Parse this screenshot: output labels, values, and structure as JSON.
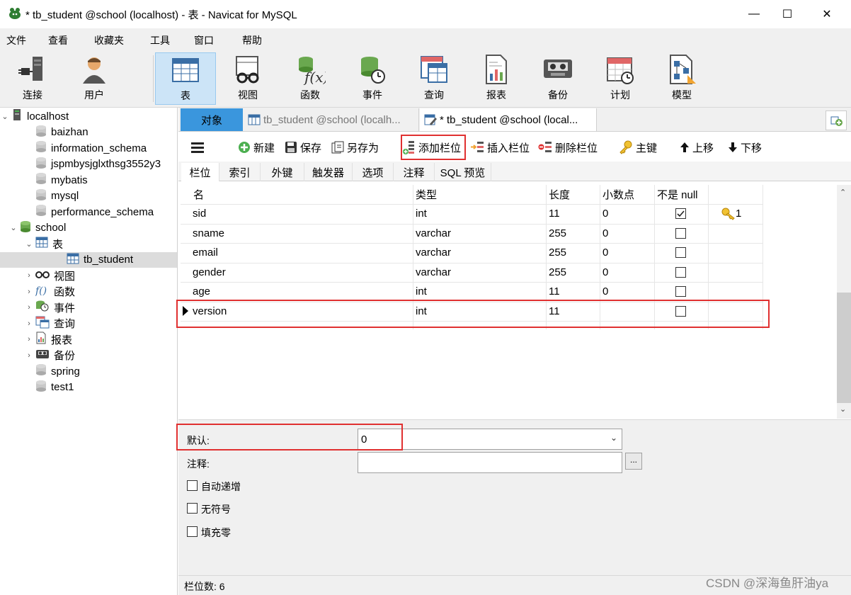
{
  "window": {
    "title": "* tb_student @school (localhost) - 表 - Navicat for MySQL",
    "minimize": "—",
    "maximize": "☐",
    "close": "✕"
  },
  "menu": [
    "文件",
    "查看",
    "收藏夹",
    "工具",
    "窗口",
    "帮助"
  ],
  "toolbar": {
    "items": [
      {
        "label": "连接",
        "icon": "connection-icon"
      },
      {
        "label": "用户",
        "icon": "user-icon"
      },
      {
        "label": "表",
        "icon": "table-icon",
        "active": true
      },
      {
        "label": "视图",
        "icon": "view-icon"
      },
      {
        "label": "函数",
        "icon": "function-icon"
      },
      {
        "label": "事件",
        "icon": "event-icon"
      },
      {
        "label": "查询",
        "icon": "query-icon"
      },
      {
        "label": "报表",
        "icon": "report-icon"
      },
      {
        "label": "备份",
        "icon": "backup-icon"
      },
      {
        "label": "计划",
        "icon": "schedule-icon"
      },
      {
        "label": "模型",
        "icon": "model-icon"
      }
    ]
  },
  "sidebar": {
    "items": [
      {
        "label": "localhost",
        "icon": "server-icon",
        "arrow": "⌄"
      },
      {
        "label": "baizhan",
        "icon": "database-icon"
      },
      {
        "label": "information_schema",
        "icon": "database-icon"
      },
      {
        "label": "jspmbysjglxthsg3552y3",
        "icon": "database-icon"
      },
      {
        "label": "mybatis",
        "icon": "database-icon"
      },
      {
        "label": "mysql",
        "icon": "database-icon"
      },
      {
        "label": "performance_schema",
        "icon": "database-icon"
      },
      {
        "label": "school",
        "icon": "database-open-icon",
        "arrow": "⌄"
      },
      {
        "label": "表",
        "icon": "table-icon",
        "arrow": "⌄"
      },
      {
        "label": "tb_student",
        "icon": "table-icon",
        "selected": true
      },
      {
        "label": "视图",
        "icon": "view-icon",
        "arrow": "›"
      },
      {
        "label": "函数",
        "icon": "function-icon",
        "arrow": "›"
      },
      {
        "label": "事件",
        "icon": "event-icon",
        "arrow": "›"
      },
      {
        "label": "查询",
        "icon": "query-icon",
        "arrow": "›"
      },
      {
        "label": "报表",
        "icon": "report-icon",
        "arrow": "›"
      },
      {
        "label": "备份",
        "icon": "backup-icon",
        "arrow": "›"
      },
      {
        "label": "spring",
        "icon": "database-icon"
      },
      {
        "label": "test1",
        "icon": "database-icon"
      }
    ]
  },
  "tabs": [
    {
      "label": "对象"
    },
    {
      "label": "tb_student @school (localh..."
    },
    {
      "label": "* tb_student @school (local..."
    }
  ],
  "designer_toolbar": {
    "new": "新建",
    "save": "保存",
    "save_as": "另存为",
    "add_field": "添加栏位",
    "insert_field": "插入栏位",
    "delete_field": "删除栏位",
    "primary_key": "主键",
    "move_up": "上移",
    "move_down": "下移"
  },
  "subtabs": [
    "栏位",
    "索引",
    "外键",
    "触发器",
    "选项",
    "注释",
    "SQL 预览"
  ],
  "grid": {
    "headers": [
      "名",
      "类型",
      "长度",
      "小数点",
      "不是 null",
      ""
    ],
    "rows": [
      {
        "name": "sid",
        "type": "int",
        "length": "11",
        "decimals": "0",
        "not_null": true,
        "key": "1"
      },
      {
        "name": "sname",
        "type": "varchar",
        "length": "255",
        "decimals": "0",
        "not_null": false,
        "key": ""
      },
      {
        "name": "email",
        "type": "varchar",
        "length": "255",
        "decimals": "0",
        "not_null": false,
        "key": ""
      },
      {
        "name": "gender",
        "type": "varchar",
        "length": "255",
        "decimals": "0",
        "not_null": false,
        "key": ""
      },
      {
        "name": "age",
        "type": "int",
        "length": "11",
        "decimals": "0",
        "not_null": false,
        "key": ""
      },
      {
        "name": "version",
        "type": "int",
        "length": "11",
        "decimals": "",
        "not_null": false,
        "key": "",
        "current": true
      }
    ]
  },
  "properties": {
    "default_label": "默认:",
    "default_value": "0",
    "comment_label": "注释:",
    "comment_value": "",
    "ellipsis": "...",
    "auto_increment": "自动递增",
    "unsigned": "无符号",
    "zerofill": "填充零"
  },
  "status": {
    "field_count": "栏位数: 6"
  },
  "watermark": "CSDN @深海鱼肝油ya",
  "colors": {
    "accent_tab": "#3a96dd",
    "highlight_box": "#e03030",
    "active_toolbar": "#cce4f7"
  }
}
